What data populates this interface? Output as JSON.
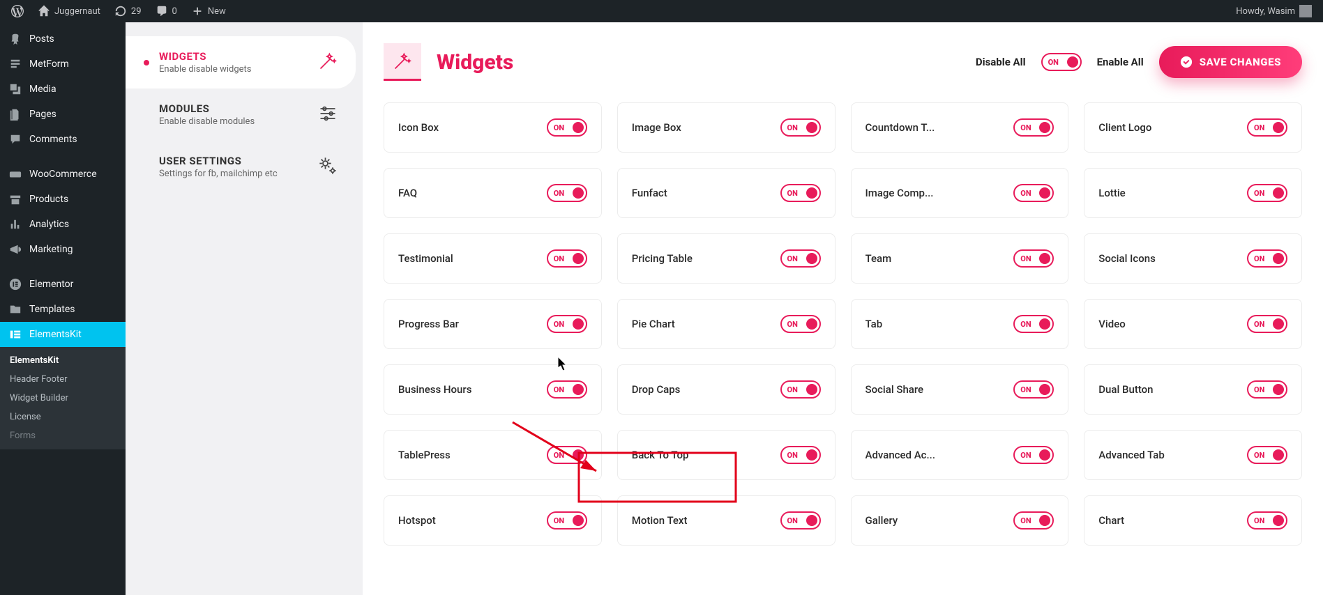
{
  "adminbar": {
    "site_name": "Juggernaut",
    "updates": "29",
    "comments": "0",
    "new": "New",
    "howdy": "Howdy, Wasim"
  },
  "sidebar": {
    "items": [
      {
        "id": "posts",
        "label": "Posts"
      },
      {
        "id": "metform",
        "label": "MetForm"
      },
      {
        "id": "media",
        "label": "Media"
      },
      {
        "id": "pages",
        "label": "Pages"
      },
      {
        "id": "comments",
        "label": "Comments"
      },
      {
        "id": "woocommerce",
        "label": "WooCommerce"
      },
      {
        "id": "products",
        "label": "Products"
      },
      {
        "id": "analytics",
        "label": "Analytics"
      },
      {
        "id": "marketing",
        "label": "Marketing"
      },
      {
        "id": "elementor",
        "label": "Elementor"
      },
      {
        "id": "templates",
        "label": "Templates"
      },
      {
        "id": "elementskit",
        "label": "ElementsKit"
      }
    ],
    "submenu": [
      {
        "label": "ElementsKit",
        "active": true
      },
      {
        "label": "Header Footer",
        "active": false
      },
      {
        "label": "Widget Builder",
        "active": false
      },
      {
        "label": "License",
        "active": false
      },
      {
        "label": "Forms",
        "active": false
      }
    ]
  },
  "tabs": [
    {
      "title": "WIDGETS",
      "desc": "Enable disable widgets",
      "active": true
    },
    {
      "title": "MODULES",
      "desc": "Enable disable modules",
      "active": false
    },
    {
      "title": "USER SETTINGS",
      "desc": "Settings for fb, mailchimp etc",
      "active": false
    }
  ],
  "panel": {
    "title": "Widgets",
    "disable_all": "Disable All",
    "enable_all": "Enable All",
    "save": "SAVE CHANGES",
    "toggle_on": "ON"
  },
  "widgets": [
    {
      "name": "Icon Box",
      "on": true
    },
    {
      "name": "Image Box",
      "on": true
    },
    {
      "name": "Countdown T...",
      "on": true
    },
    {
      "name": "Client Logo",
      "on": true
    },
    {
      "name": "FAQ",
      "on": true
    },
    {
      "name": "Funfact",
      "on": true
    },
    {
      "name": "Image Comp...",
      "on": true
    },
    {
      "name": "Lottie",
      "on": true
    },
    {
      "name": "Testimonial",
      "on": true
    },
    {
      "name": "Pricing Table",
      "on": true
    },
    {
      "name": "Team",
      "on": true
    },
    {
      "name": "Social Icons",
      "on": true
    },
    {
      "name": "Progress Bar",
      "on": true
    },
    {
      "name": "Pie Chart",
      "on": true
    },
    {
      "name": "Tab",
      "on": true
    },
    {
      "name": "Video",
      "on": true
    },
    {
      "name": "Business Hours",
      "on": true
    },
    {
      "name": "Drop Caps",
      "on": true
    },
    {
      "name": "Social Share",
      "on": true
    },
    {
      "name": "Dual Button",
      "on": true
    },
    {
      "name": "TablePress",
      "on": true
    },
    {
      "name": "Back To Top",
      "on": true
    },
    {
      "name": "Advanced Ac...",
      "on": true
    },
    {
      "name": "Advanced Tab",
      "on": true
    },
    {
      "name": "Hotspot",
      "on": true
    },
    {
      "name": "Motion Text",
      "on": true
    },
    {
      "name": "Gallery",
      "on": true
    },
    {
      "name": "Chart",
      "on": true
    }
  ]
}
